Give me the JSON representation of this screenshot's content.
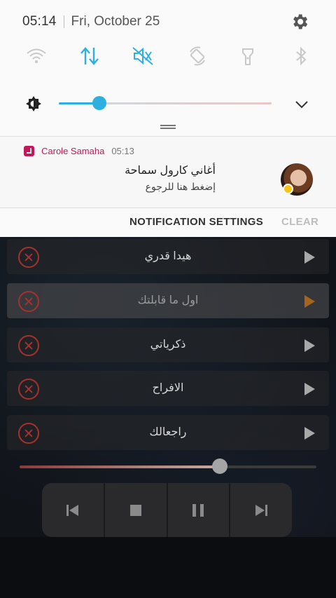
{
  "status": {
    "time": "05:14",
    "date": "Fri, October 25"
  },
  "quick_toggles": [
    {
      "name": "wifi",
      "active": false
    },
    {
      "name": "mobile-data",
      "active": true
    },
    {
      "name": "sound-mute",
      "active": true
    },
    {
      "name": "auto-rotate",
      "active": false
    },
    {
      "name": "flashlight",
      "active": false
    },
    {
      "name": "bluetooth",
      "active": false
    }
  ],
  "brightness": {
    "level": 0.19
  },
  "colors": {
    "accent": "#2db0e0",
    "app_accent": "#c2185b",
    "danger": "#a3332c",
    "playing": "#a5651f"
  },
  "notification": {
    "app_name": "Carole Samaha",
    "time": "05:13",
    "title": "أغاني كارول سماحة",
    "text": "إضغط هنا للرجوع",
    "settings_label": "NOTIFICATION SETTINGS",
    "clear_label": "CLEAR"
  },
  "tracks": [
    {
      "title": "هيدا قدري",
      "active": false
    },
    {
      "title": "اول ما قابلتك",
      "active": true
    },
    {
      "title": "ذكرياتي",
      "active": false
    },
    {
      "title": "الافراح",
      "active": false
    },
    {
      "title": "راجعالك",
      "active": false
    }
  ],
  "player": {
    "progress": 0.67
  }
}
